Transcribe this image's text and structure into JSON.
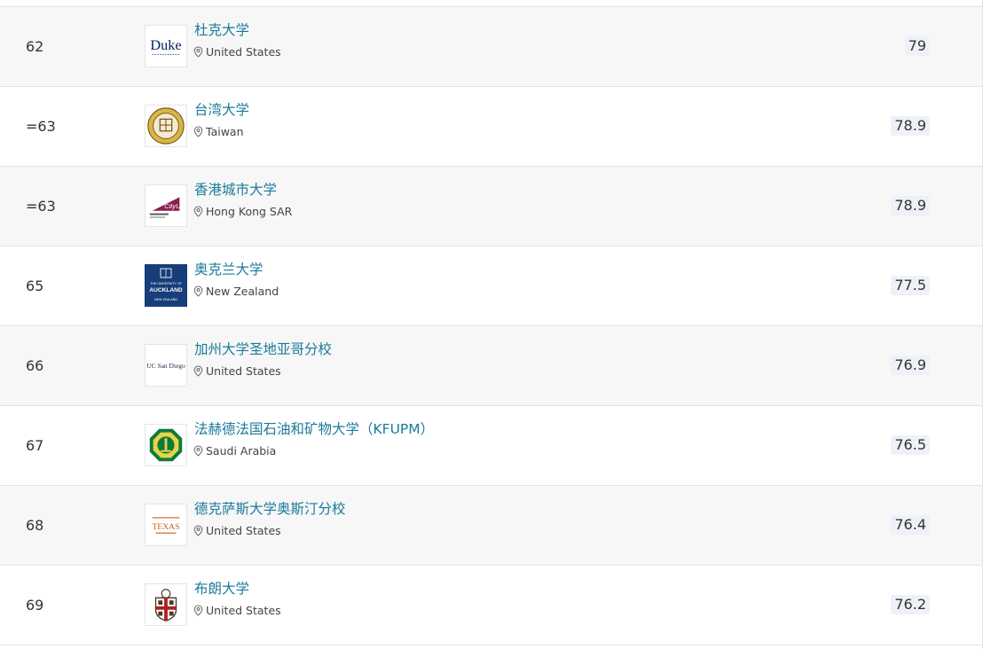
{
  "rows": [
    {
      "rank": "62",
      "name": "杜克大学",
      "location": "United States",
      "score": "79",
      "logo": "duke-logo"
    },
    {
      "rank": "=63",
      "name": "台湾大学",
      "location": "Taiwan",
      "score": "78.9",
      "logo": "ntu-taiwan-logo"
    },
    {
      "rank": "=63",
      "name": "香港城市大学",
      "location": "Hong Kong SAR",
      "score": "78.9",
      "logo": "cityu-logo"
    },
    {
      "rank": "65",
      "name": "奥克兰大学",
      "location": "New Zealand",
      "score": "77.5",
      "logo": "auckland-logo"
    },
    {
      "rank": "66",
      "name": "加州大学圣地亚哥分校",
      "location": "United States",
      "score": "76.9",
      "logo": "ucsd-logo"
    },
    {
      "rank": "67",
      "name": "法赫德法国石油和矿物大学（KFUPM）",
      "location": "Saudi Arabia",
      "score": "76.5",
      "logo": "kfupm-logo"
    },
    {
      "rank": "68",
      "name": "德克萨斯大学奥斯汀分校",
      "location": "United States",
      "score": "76.4",
      "logo": "ut-austin-logo"
    },
    {
      "rank": "69",
      "name": "布朗大学",
      "location": "United States",
      "score": "76.2",
      "logo": "brown-logo"
    }
  ],
  "logo_text": {
    "duke": "Duke",
    "cityu": "CityU",
    "auckland_1": "THE UNIVERSITY OF",
    "auckland_2": "AUCKLAND",
    "auckland_3": "NEW ZEALAND",
    "ucsd": "UC San Diego",
    "texas": "TEXAS"
  },
  "colors": {
    "link": "#1a7a9a",
    "row_alt": "#f7f7f7",
    "score_bg": "#eef1f7",
    "auckland_blue": "#173d7a",
    "cityu_magenta": "#8b1f4f",
    "texas_orange": "#c8641e",
    "brown_red": "#b11f24",
    "kfupm_green": "#0e7a3a"
  }
}
